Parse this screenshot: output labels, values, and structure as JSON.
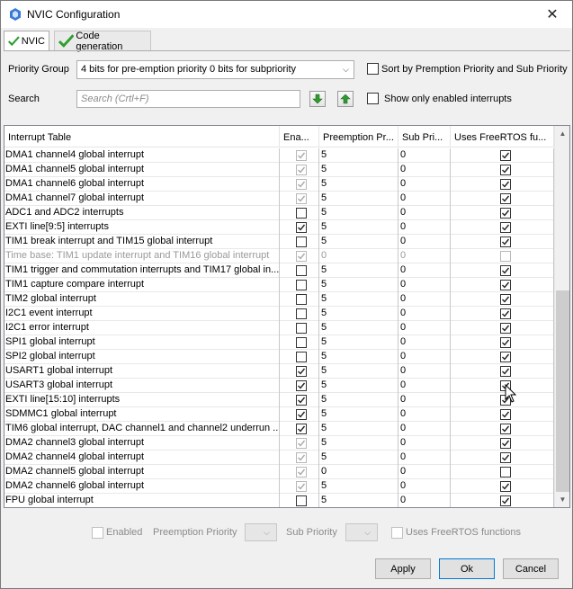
{
  "window": {
    "title": "NVIC Configuration"
  },
  "tabs": [
    {
      "label": "NVIC",
      "active": true
    },
    {
      "label": "Code generation",
      "active": false
    }
  ],
  "priority_group": {
    "label": "Priority Group",
    "value": "4 bits for pre-emption priority 0 bits for subpriority",
    "sort_label": "Sort by Premption Priority and Sub Priority",
    "sort_checked": false
  },
  "search": {
    "label": "Search",
    "placeholder": "Search (Crtl+F)",
    "show_only_label": "Show only enabled interrupts",
    "show_only_checked": false
  },
  "table": {
    "columns": [
      "Interrupt Table",
      "Ena...",
      "Preemption Pr...",
      "Sub Pri...",
      "Uses FreeRTOS fu..."
    ],
    "rows": [
      {
        "name": "DMA1 channel4 global interrupt",
        "enabled": true,
        "enabled_disabled": true,
        "pre": "5",
        "sub": "0",
        "rtos": true,
        "grey": false,
        "rtos_disabled": false
      },
      {
        "name": "DMA1 channel5 global interrupt",
        "enabled": true,
        "enabled_disabled": true,
        "pre": "5",
        "sub": "0",
        "rtos": true,
        "grey": false,
        "rtos_disabled": false
      },
      {
        "name": "DMA1 channel6 global interrupt",
        "enabled": true,
        "enabled_disabled": true,
        "pre": "5",
        "sub": "0",
        "rtos": true,
        "grey": false,
        "rtos_disabled": false
      },
      {
        "name": "DMA1 channel7 global interrupt",
        "enabled": true,
        "enabled_disabled": true,
        "pre": "5",
        "sub": "0",
        "rtos": true,
        "grey": false,
        "rtos_disabled": false
      },
      {
        "name": "ADC1 and ADC2 interrupts",
        "enabled": false,
        "enabled_disabled": false,
        "pre": "5",
        "sub": "0",
        "rtos": true,
        "grey": false,
        "rtos_disabled": false
      },
      {
        "name": "EXTI line[9:5] interrupts",
        "enabled": true,
        "enabled_disabled": false,
        "pre": "5",
        "sub": "0",
        "rtos": true,
        "grey": false,
        "rtos_disabled": false
      },
      {
        "name": "TIM1 break interrupt and TIM15 global interrupt",
        "enabled": false,
        "enabled_disabled": false,
        "pre": "5",
        "sub": "0",
        "rtos": true,
        "grey": false,
        "rtos_disabled": false
      },
      {
        "name": "Time base: TIM1 update interrupt and TIM16 global interrupt",
        "enabled": true,
        "enabled_disabled": true,
        "pre": "0",
        "sub": "0",
        "rtos": false,
        "grey": true,
        "rtos_disabled": true
      },
      {
        "name": "TIM1 trigger and commutation interrupts and TIM17 global in...",
        "enabled": false,
        "enabled_disabled": false,
        "pre": "5",
        "sub": "0",
        "rtos": true,
        "grey": false,
        "rtos_disabled": false
      },
      {
        "name": "TIM1 capture compare interrupt",
        "enabled": false,
        "enabled_disabled": false,
        "pre": "5",
        "sub": "0",
        "rtos": true,
        "grey": false,
        "rtos_disabled": false
      },
      {
        "name": "TIM2 global interrupt",
        "enabled": false,
        "enabled_disabled": false,
        "pre": "5",
        "sub": "0",
        "rtos": true,
        "grey": false,
        "rtos_disabled": false
      },
      {
        "name": "I2C1 event interrupt",
        "enabled": false,
        "enabled_disabled": false,
        "pre": "5",
        "sub": "0",
        "rtos": true,
        "grey": false,
        "rtos_disabled": false
      },
      {
        "name": "I2C1 error interrupt",
        "enabled": false,
        "enabled_disabled": false,
        "pre": "5",
        "sub": "0",
        "rtos": true,
        "grey": false,
        "rtos_disabled": false
      },
      {
        "name": "SPI1 global interrupt",
        "enabled": false,
        "enabled_disabled": false,
        "pre": "5",
        "sub": "0",
        "rtos": true,
        "grey": false,
        "rtos_disabled": false
      },
      {
        "name": "SPI2 global interrupt",
        "enabled": false,
        "enabled_disabled": false,
        "pre": "5",
        "sub": "0",
        "rtos": true,
        "grey": false,
        "rtos_disabled": false
      },
      {
        "name": "USART1 global interrupt",
        "enabled": true,
        "enabled_disabled": false,
        "pre": "5",
        "sub": "0",
        "rtos": true,
        "grey": false,
        "rtos_disabled": false
      },
      {
        "name": "USART3 global interrupt",
        "enabled": true,
        "enabled_disabled": false,
        "pre": "5",
        "sub": "0",
        "rtos": true,
        "grey": false,
        "rtos_disabled": false
      },
      {
        "name": "EXTI line[15:10] interrupts",
        "enabled": true,
        "enabled_disabled": false,
        "pre": "5",
        "sub": "0",
        "rtos": true,
        "grey": false,
        "rtos_disabled": false
      },
      {
        "name": "SDMMC1 global interrupt",
        "enabled": true,
        "enabled_disabled": false,
        "pre": "5",
        "sub": "0",
        "rtos": true,
        "grey": false,
        "rtos_disabled": false
      },
      {
        "name": "TIM6 global interrupt, DAC channel1 and channel2 underrun ...",
        "enabled": true,
        "enabled_disabled": false,
        "pre": "5",
        "sub": "0",
        "rtos": true,
        "grey": false,
        "rtos_disabled": false
      },
      {
        "name": "DMA2 channel3 global interrupt",
        "enabled": true,
        "enabled_disabled": true,
        "pre": "5",
        "sub": "0",
        "rtos": true,
        "grey": false,
        "rtos_disabled": false
      },
      {
        "name": "DMA2 channel4 global interrupt",
        "enabled": true,
        "enabled_disabled": true,
        "pre": "5",
        "sub": "0",
        "rtos": true,
        "grey": false,
        "rtos_disabled": false
      },
      {
        "name": "DMA2 channel5 global interrupt",
        "enabled": true,
        "enabled_disabled": true,
        "pre": "0",
        "sub": "0",
        "rtos": false,
        "grey": false,
        "rtos_disabled": false
      },
      {
        "name": "DMA2 channel6 global interrupt",
        "enabled": true,
        "enabled_disabled": true,
        "pre": "5",
        "sub": "0",
        "rtos": true,
        "grey": false,
        "rtos_disabled": false
      },
      {
        "name": "FPU global interrupt",
        "enabled": false,
        "enabled_disabled": false,
        "pre": "5",
        "sub": "0",
        "rtos": true,
        "grey": false,
        "rtos_disabled": false
      }
    ]
  },
  "details": {
    "enabled_label": "Enabled",
    "preemption_label": "Preemption Priority",
    "sub_label": "Sub Priority",
    "rtos_label": "Uses FreeRTOS functions"
  },
  "buttons": {
    "apply": "Apply",
    "ok": "Ok",
    "cancel": "Cancel"
  },
  "colors": {
    "check_green": "#2e9e2e",
    "arrow_green": "#2f9a2f"
  }
}
